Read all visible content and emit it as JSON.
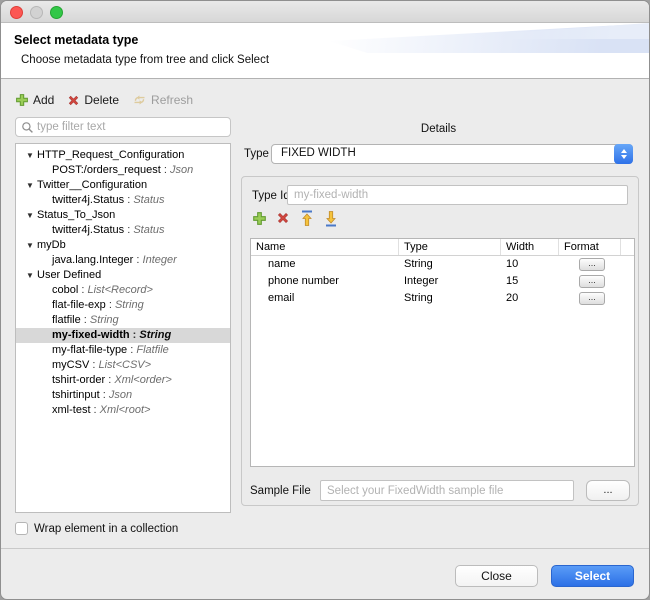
{
  "header": {
    "title": "Select metadata type",
    "subtitle": "Choose metadata type from tree and click Select"
  },
  "toolbar": {
    "add_label": "Add",
    "delete_label": "Delete",
    "refresh_label": "Refresh"
  },
  "filter": {
    "placeholder": "type filter text"
  },
  "icons": {
    "disclosure": "▼"
  },
  "tree": {
    "sep": " : ",
    "items": [
      {
        "label": "HTTP_Request_Configuration",
        "type": "",
        "level": 0
      },
      {
        "label": "POST:/orders_request",
        "type": "Json",
        "level": 1
      },
      {
        "label": "Twitter__Configuration",
        "type": "",
        "level": 0
      },
      {
        "label": "twitter4j.Status",
        "type": "Status",
        "level": 1
      },
      {
        "label": "Status_To_Json",
        "type": "",
        "level": 0
      },
      {
        "label": "twitter4j.Status",
        "type": "Status",
        "level": 1
      },
      {
        "label": "myDb",
        "type": "",
        "level": 0
      },
      {
        "label": "java.lang.Integer",
        "type": "Integer",
        "level": 1
      },
      {
        "label": "User Defined",
        "type": "",
        "level": 0
      },
      {
        "label": "cobol",
        "type": "List<Record>",
        "level": 1
      },
      {
        "label": "flat-file-exp",
        "type": "String",
        "level": 1
      },
      {
        "label": "flatfile",
        "type": "String",
        "level": 1
      },
      {
        "label": "my-fixed-width",
        "type": "String",
        "level": 1,
        "selected": true
      },
      {
        "label": "my-flat-file-type",
        "type": "Flatfile",
        "level": 1
      },
      {
        "label": "myCSV",
        "type": "List<CSV>",
        "level": 1
      },
      {
        "label": "tshirt-order",
        "type": "Xml<order>",
        "level": 1
      },
      {
        "label": "tshirtinput",
        "type": "Json",
        "level": 1
      },
      {
        "label": "xml-test",
        "type": "Xml<root>",
        "level": 1
      }
    ]
  },
  "details": {
    "title": "Details",
    "type_label": "Type",
    "type_value": "FIXED WIDTH",
    "type_id_label": "Type Id",
    "type_id_placeholder": "my-fixed-width",
    "columns": [
      "Name",
      "Type",
      "Width",
      "Format"
    ],
    "rows": [
      {
        "name": "name",
        "type": "String",
        "width": "10",
        "format": "..."
      },
      {
        "name": "phone number",
        "type": "Integer",
        "width": "15",
        "format": "..."
      },
      {
        "name": "email",
        "type": "String",
        "width": "20",
        "format": "..."
      }
    ],
    "sample_file_label": "Sample File",
    "sample_file_placeholder": "Select your FixedWidth sample file",
    "browse_label": "..."
  },
  "footer": {
    "wrap_label": "Wrap element in a collection",
    "close_label": "Close",
    "select_label": "Select"
  },
  "colors": {
    "accent_blue": "#2e71e8",
    "select_button_blue": "#3a82ec",
    "add_green": "#9acd57",
    "delete_red": "#d24840",
    "arrow_gold": "#f5c33c",
    "header_wisp_blue": "#d9e2f5",
    "selection_gray": "#d8d8d8"
  }
}
